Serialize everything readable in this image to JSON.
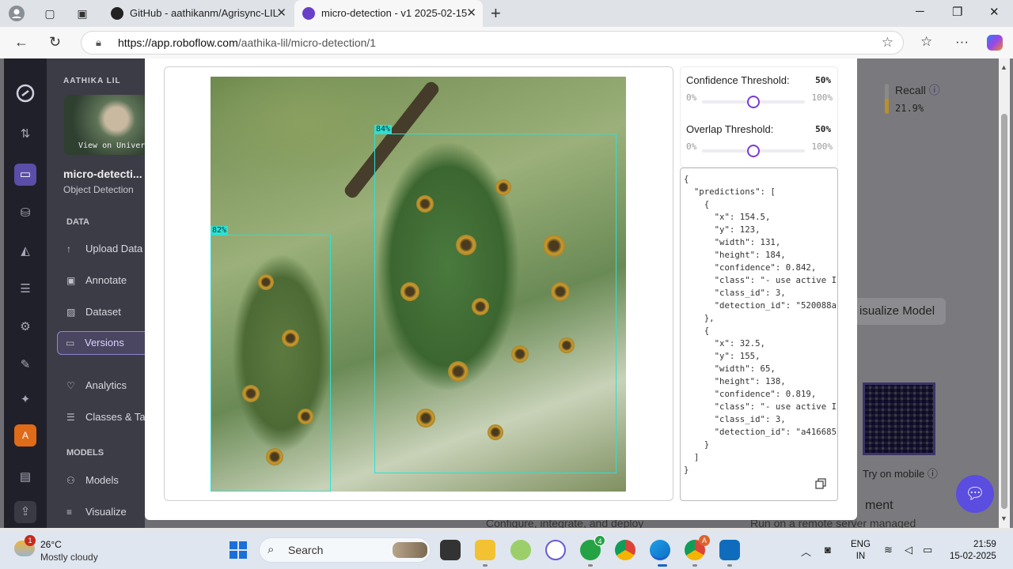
{
  "browser": {
    "tabs": [
      {
        "title": "GitHub - aathikanm/Agrisync-LIL",
        "active": false
      },
      {
        "title": "micro-detection - v1 2025-02-15",
        "active": true
      }
    ],
    "url_host": "https://app.roboflow.com",
    "url_path": "/aathika-lil/micro-detection/1"
  },
  "sidebar": {
    "workspace": "AATHIKA LIL",
    "thumb_caption": "View on Universe",
    "project_name": "micro-detecti...",
    "project_type": "Object Detection",
    "section_data": "DATA",
    "items_data": [
      "Upload Data",
      "Annotate",
      "Dataset",
      "Versions",
      "Analytics",
      "Classes & Tags"
    ],
    "section_models": "MODELS",
    "items_models": [
      "Models",
      "Visualize"
    ]
  },
  "background": {
    "recall_label": "Recall",
    "recall_value": "21.9%",
    "visualize_button": "isualize Model",
    "try_mobile": "Try on mobile",
    "deploy_heading": "ment",
    "configure_text": "Configure, integrate, and deploy",
    "remote_text": "Run on a remote server managed"
  },
  "detections": [
    {
      "label": "84%"
    },
    {
      "label": "82%"
    }
  ],
  "thresholds": {
    "confidence": {
      "label": "Confidence Threshold:",
      "value": "50%",
      "min": "0%",
      "max": "100%",
      "level": 0.5
    },
    "overlap": {
      "label": "Overlap Threshold:",
      "value": "50%",
      "min": "0%",
      "max": "100%",
      "level": 0.5
    }
  },
  "json_output": "{\n  \"predictions\": [\n    {\n      \"x\": 154.5,\n      \"y\": 123,\n      \"width\": 131,\n      \"height\": 184,\n      \"confidence\": 0.842,\n      \"class\": \"- use active I\n      \"class_id\": 3,\n      \"detection_id\": \"520088a\n    },\n    {\n      \"x\": 32.5,\n      \"y\": 155,\n      \"width\": 65,\n      \"height\": 138,\n      \"confidence\": 0.819,\n      \"class\": \"- use active I\n      \"class_id\": 3,\n      \"detection_id\": \"a416685\n    }\n  ]\n}",
  "taskbar": {
    "weather_temp": "26°C",
    "weather_desc": "Mostly cloudy",
    "weather_badge": "1",
    "search_label": "Search",
    "whatsapp_badge": "4",
    "chrome_badge": "A",
    "lang_line1": "ENG",
    "lang_line2": "IN",
    "time": "21:59",
    "date": "15-02-2025"
  },
  "colors": {
    "accent": "#7a3bd8",
    "bbox": "#2fe0d0",
    "rail_selected": "#5a4ea8"
  }
}
